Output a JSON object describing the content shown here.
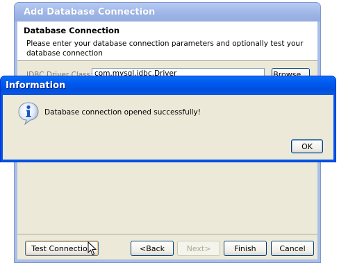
{
  "main_window": {
    "title": "Add Database Connection",
    "header_title": "Database Connection",
    "header_description": "Please enter your database connection parameters and optionally test your database connection",
    "driver_label": "JDBC Driver Class:",
    "driver_value": "com.mysql.jdbc.Driver",
    "browse_label": "Browse...",
    "buttons": {
      "test": "Test Connection",
      "back": "<Back",
      "next": "Next>",
      "finish": "Finish",
      "cancel": "Cancel"
    }
  },
  "info_dialog": {
    "title": "Information",
    "icon": "info-icon",
    "message": "Database connection opened successfully!",
    "ok_label": "OK"
  }
}
